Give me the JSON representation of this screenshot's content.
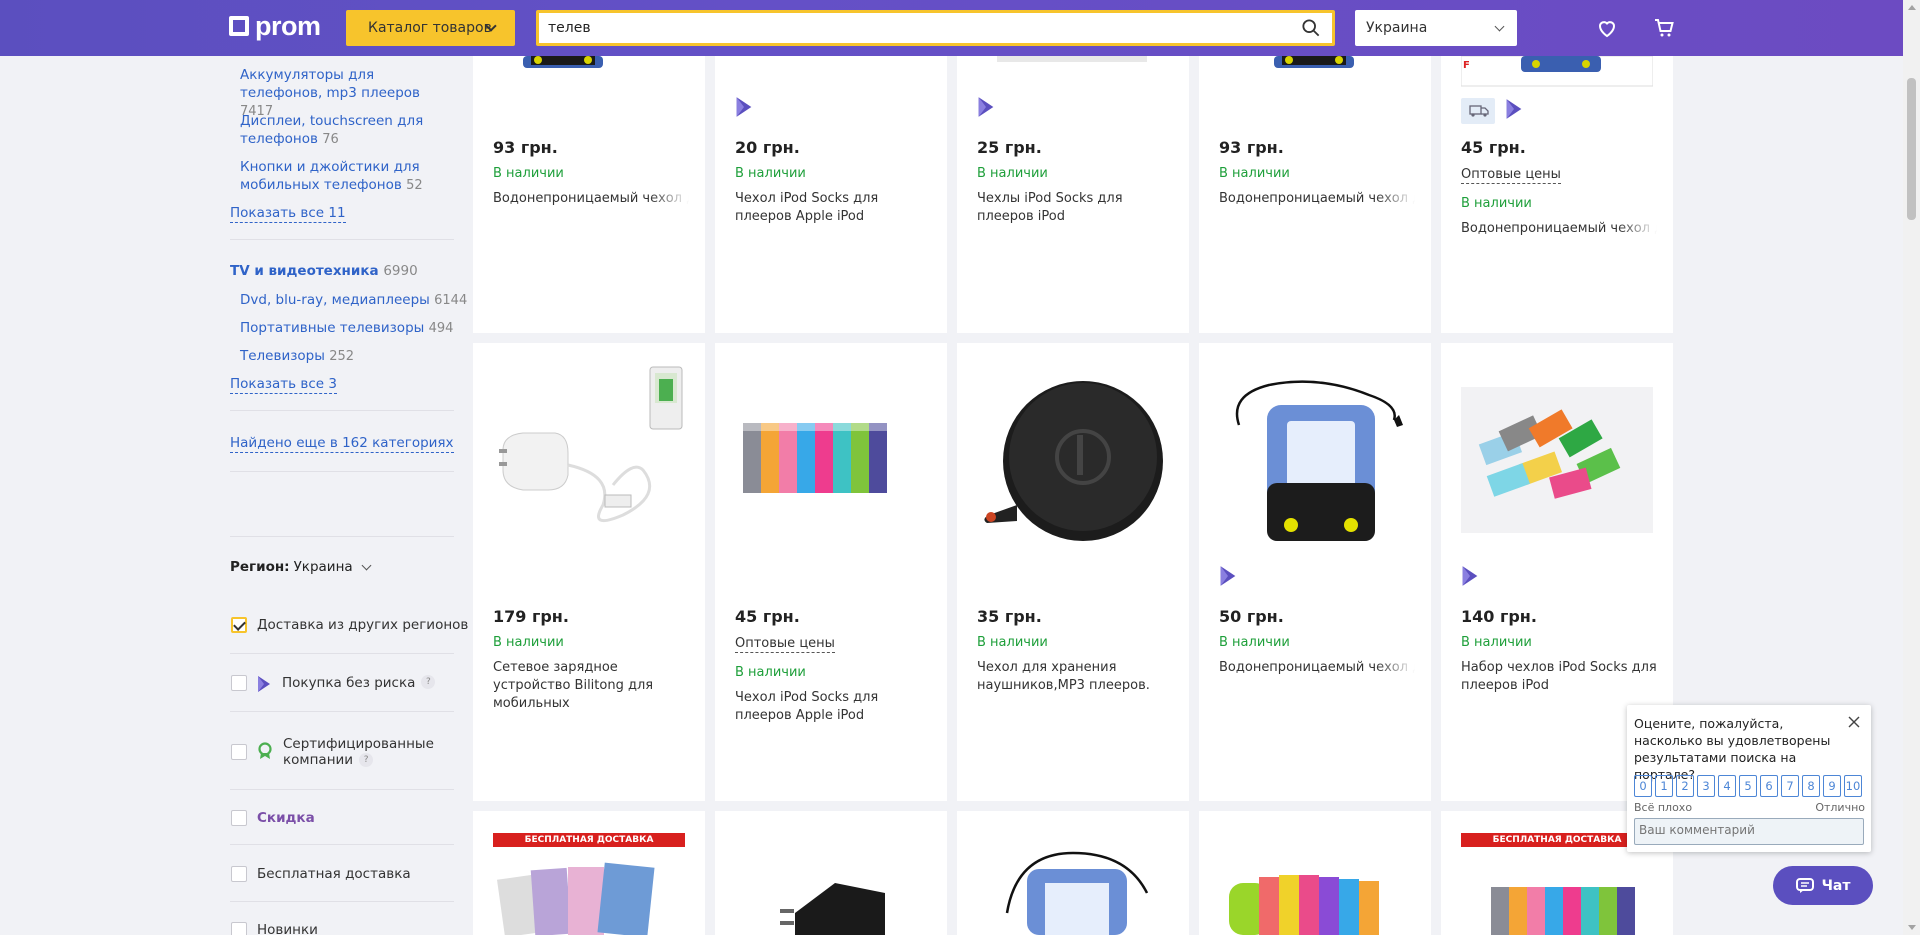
{
  "header": {
    "logo": "prom",
    "catalog_label": "Каталог товаров",
    "search_value": "телев",
    "region": "Украина"
  },
  "sidebar": {
    "subcats_phones": [
      {
        "label": "Аккумуляторы для телефонов, mp3 плееров",
        "count": "7417"
      },
      {
        "label": "Дисплеи, touchscreen для телефонов",
        "count": "76"
      },
      {
        "label": "Кнопки и джойстики для мобильных телефонов",
        "count": "52"
      }
    ],
    "show_all_1": "Показать все 11",
    "tv_category": {
      "label": "TV и видеотехника",
      "count": "6990"
    },
    "subcats_tv": [
      {
        "label": "Dvd, blu-ray, медиаплееры",
        "count": "6144"
      },
      {
        "label": "Портативные телевизоры",
        "count": "494"
      },
      {
        "label": "Телевизоры",
        "count": "252"
      }
    ],
    "show_all_2": "Показать все 3",
    "found_more": "Найдено еще в 162 категориях",
    "region_label": "Регион:",
    "region_value": "Украина",
    "filters": {
      "delivery_other": "Доставка из других регионов",
      "no_risk": "Покупка без риска",
      "certified": "Сертифицированные компании",
      "discount": "Скидка",
      "free_delivery": "Бесплатная доставка",
      "new": "Новинки"
    },
    "help": "?"
  },
  "products_row1": [
    {
      "price": "93 грн.",
      "stock": "В наличии",
      "title": "Водонепроницаемый чехол для телефона плеера камеры"
    },
    {
      "price": "20 грн.",
      "stock": "В наличии",
      "title": "Чехол iPod Socks для плееров Apple iPod"
    },
    {
      "price": "25 грн.",
      "stock": "В наличии",
      "title": "Чехлы iPod Socks для плееров iPod"
    },
    {
      "price": "93 грн.",
      "stock": "В наличии",
      "title": "Водонепроницаемый чехол для телефона плеера камеры"
    },
    {
      "price": "45 грн.",
      "wholesale": "Оптовые цены",
      "stock": "В наличии",
      "title": "Водонепроницаемый чехол для телефона плеера камеры"
    }
  ],
  "products_row2": [
    {
      "price": "179 грн.",
      "stock": "В наличии",
      "title": "Сетевое зарядное устройство Bilitong для мобильных"
    },
    {
      "price": "45 грн.",
      "wholesale": "Оптовые цены",
      "stock": "В наличии",
      "title": "Чехол iPod Socks для плееров Apple iPod"
    },
    {
      "price": "35 грн.",
      "stock": "В наличии",
      "title": "Чехол для хранения наушников,MP3 плееров."
    },
    {
      "price": "50 грн.",
      "stock": "В наличии",
      "title": "Водонепроницаемый чехол для телефона плеера камеры"
    },
    {
      "price": "140 грн.",
      "stock": "В наличии",
      "title": "Набор чехлов iPod Socks для плееров iPod"
    }
  ],
  "promo_banner": "БЕСПЛАТНАЯ ДОСТАВКА УКРПОЧТОЙ",
  "feedback": {
    "question": "Оцените, пожалуйста, насколько вы удовлетворены результатами поиска на портале?",
    "scale": [
      "0",
      "1",
      "2",
      "3",
      "4",
      "5",
      "6",
      "7",
      "8",
      "9",
      "10"
    ],
    "low_label": "Всё плохо",
    "high_label": "Отлично",
    "comment_placeholder": "Ваш комментарий"
  },
  "chat_label": "Чат",
  "colors": {
    "brand": "#5b4fbf",
    "accent": "#f7c42c",
    "link": "#2f63c8",
    "in_stock": "#1e9f3a"
  }
}
